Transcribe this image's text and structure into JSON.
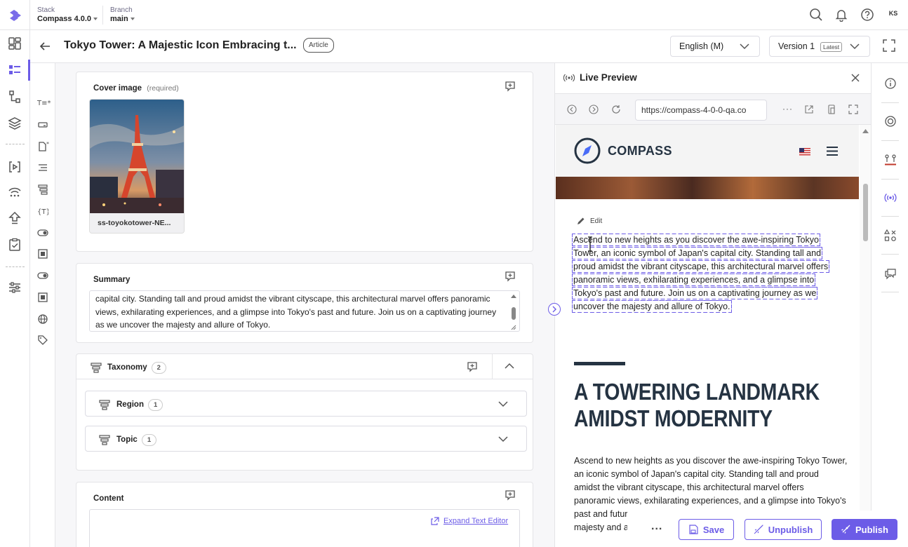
{
  "header": {
    "stack_label": "Stack",
    "stack_value": "Compass 4.0.0",
    "branch_label": "Branch",
    "branch_value": "main",
    "user_initials": "KS"
  },
  "entry": {
    "title": "Tokyo Tower: A Majestic Icon Embracing t...",
    "type_badge": "Article",
    "language": "English (M)",
    "version": "Version 1",
    "version_tag": "Latest"
  },
  "form": {
    "cover": {
      "label": "Cover image",
      "required": "(required)",
      "file_name": "ss-toyokotower-NE..."
    },
    "summary": {
      "label": "Summary",
      "text": "capital city. Standing tall and proud amidst the vibrant cityscape, this architectural marvel offers panoramic views, exhilarating experiences, and a glimpse into Tokyo's past and future. Join us on a captivating journey as we uncover the majesty and allure of Tokyo."
    },
    "taxonomy": {
      "label": "Taxonomy",
      "count": "2",
      "items": [
        {
          "label": "Region",
          "count": "1"
        },
        {
          "label": "Topic",
          "count": "1"
        }
      ]
    },
    "content": {
      "label": "Content",
      "expand_link": "Expand Text Editor"
    }
  },
  "preview": {
    "title": "Live Preview",
    "url": "https://compass-4-0-0-qa.co",
    "brand": "COMPASS",
    "edit_label": "Edit",
    "highlight_text": "Ascend to new heights as you discover the awe-inspiring Tokyo Tower, an iconic symbol of Japan's capital city. Standing tall and proud amidst the vibrant cityscape, this architectural marvel offers panoramic views, exhilarating experiences, and a glimpse into Tokyo's past and future. Join us on a captivating journey as we uncover the majesty and allure of Tokyo.",
    "heading_line1": "A TOWERING LANDMARK",
    "heading_line2": "AMIDST MODERNITY",
    "body_lines": [
      "Ascend to new heights as you discover the awe-inspiring Tokyo Tower,",
      "an iconic symbol of Japan's capital city. Standing tall and proud",
      "amidst the vibrant cityscape, this architectural marvel offers",
      "panoramic views, exhilarating experiences, and a glimpse into Tokyo's",
      "past and futur",
      "majesty and a"
    ]
  },
  "actions": {
    "more": "...",
    "save": "Save",
    "unpublish": "Unpublish",
    "publish": "Publish"
  },
  "colors": {
    "accent": "#6c5ce7",
    "publish_bg": "#6c5ce7",
    "preview_heading": "#253342",
    "dashed_outline": "#6c5ce7"
  }
}
